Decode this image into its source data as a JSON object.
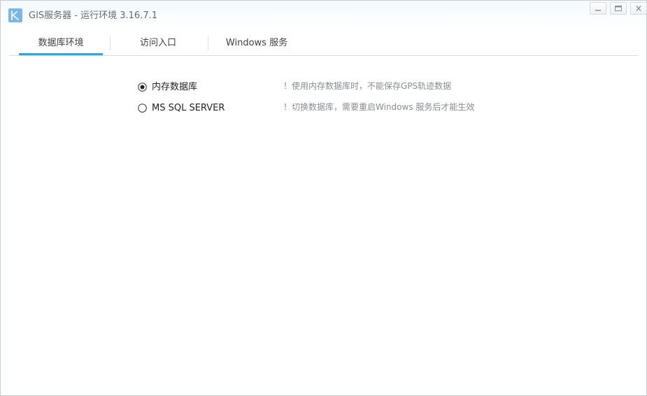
{
  "window": {
    "title": "GIS服务器 - 运行环境 3.16.7.1",
    "accent_color": "#3aa0d8",
    "logo_color": "#78b7e6"
  },
  "tabs": [
    {
      "label": "数据库环境",
      "active": true
    },
    {
      "label": "访问入口",
      "active": false
    },
    {
      "label": "Windows 服务",
      "active": false
    }
  ],
  "database": {
    "options": [
      {
        "label": "内存数据库",
        "selected": true,
        "hint": "！使用内存数据库时，不能保存GPS轨迹数据"
      },
      {
        "label": "MS SQL SERVER",
        "selected": false,
        "hint": "！切换数据库，需要重启Windows 服务后才能生效"
      }
    ]
  }
}
